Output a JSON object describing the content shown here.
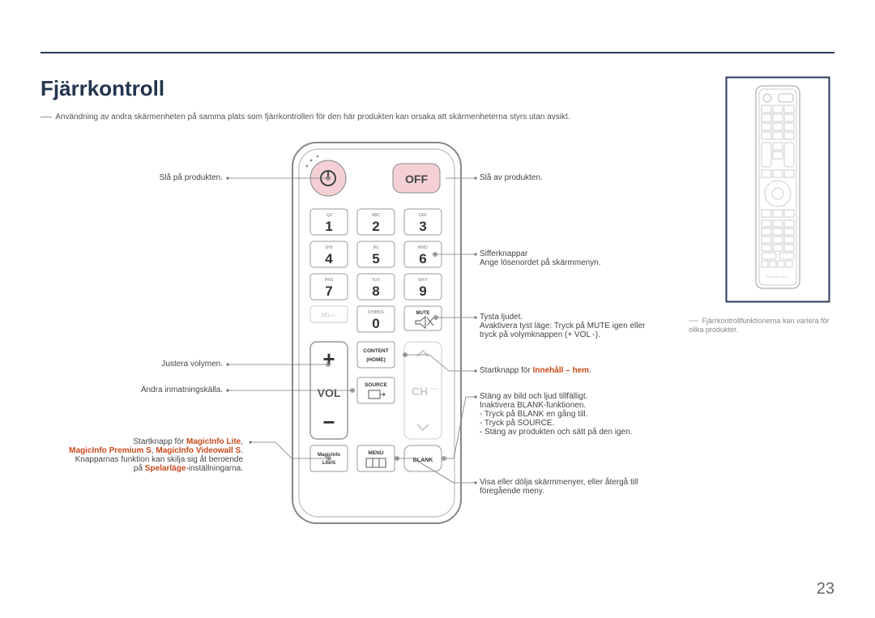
{
  "title": "Fjärrkontroll",
  "intro": "Användning av andra skärmenheten på samma plats som fjärrkontrollen för den här produkten kan orsaka att skärmenheterna styrs utan avsikt.",
  "page_number": "23",
  "labels": {
    "left": {
      "power_on": "Slå på produkten.",
      "volume": "Justera volymen.",
      "source": "Ändra inmatningskälla.",
      "magic1": "Startknapp för ",
      "magic_lite": "MagicInfo Lite",
      "magic_comma1": ",",
      "magic_premium": "MagicInfo Premium S",
      "magic_comma2": ", ",
      "magic_videowall": "MagicInfo Videowall S",
      "magic_period": ".",
      "magic_note1": "Knapparnas funktion kan skilja sig åt beroende",
      "magic_note2_pre": "på ",
      "magic_note2_hl": "Spelarläge",
      "magic_note2_post": "-inställningarna."
    },
    "right": {
      "power_off": "Slå av produkten.",
      "number1": "Sifferknappar",
      "number2": "Ange lösenordet på skärmmenyn.",
      "mute1": "Tysta ljudet.",
      "mute2": "Avaktivera tyst läge: Tryck på MUTE igen eller",
      "mute3": "tryck på volymknappen (+ VOL -).",
      "content_pre": "Startknapp för ",
      "content_hl": "Innehåll – hem",
      "content_post": ".",
      "blank1": "Stäng av  bild och ljud tillfälligt.",
      "blank2": "Inaktivera BLANK-funktionen.",
      "blank3": "- Tryck på BLANK en gång till.",
      "blank4": "- Tryck på SOURCE.",
      "blank5": "- Stäng av  produkten och sätt på den igen.",
      "menu1": "Visa eller dölja skärmmenyer, eller återgå till",
      "menu2": "föregående meny."
    }
  },
  "remote": {
    "off": "OFF",
    "keys": [
      {
        "sup": ".QZ",
        "num": "1"
      },
      {
        "sup": "ABC",
        "num": "2"
      },
      {
        "sup": "DEF",
        "num": "3"
      },
      {
        "sup": "GHI",
        "num": "4"
      },
      {
        "sup": "JKL",
        "num": "5"
      },
      {
        "sup": "MNO",
        "num": "6"
      },
      {
        "sup": "PRS",
        "num": "7"
      },
      {
        "sup": "TUV",
        "num": "8"
      },
      {
        "sup": "WXY",
        "num": "9"
      }
    ],
    "del": "DEL-/--",
    "symbol": "SYMBOL",
    "zero": "0",
    "mute": "MUTE",
    "vol": "VOL",
    "ch": "CH",
    "content": "CONTENT",
    "home": "(HOME)",
    "source": "SOURCE",
    "menu": "MENU",
    "magic1": "MagicInfo",
    "magic2": "Lite/S",
    "blank": "BLANK",
    "side_brand": "SAMSUNG"
  },
  "side_note": "Fjärrkontrollfunktionerna kan variera för olika produkter."
}
